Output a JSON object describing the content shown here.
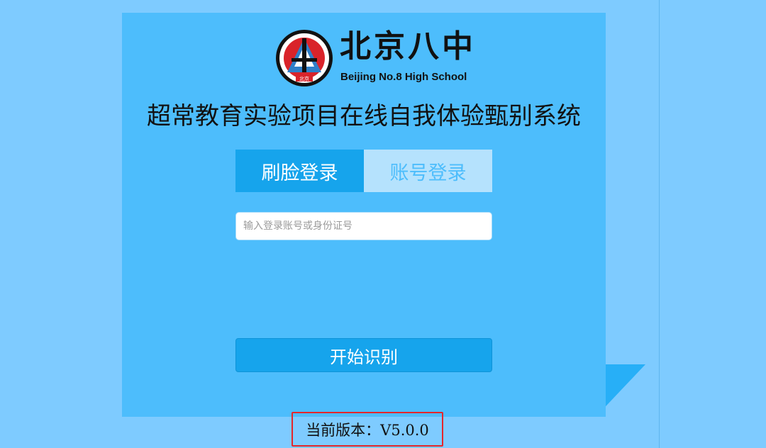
{
  "logo": {
    "name_cn": "北京八中",
    "name_en": "Beijing No.8 High School",
    "emblem_text": "北京"
  },
  "page_title": "超常教育实验项目在线自我体验甄别系统",
  "tabs": [
    {
      "label": "刷脸登录",
      "active": true
    },
    {
      "label": "账号登录",
      "active": false
    }
  ],
  "account_input": {
    "value": "",
    "placeholder": "输入登录账号或身份证号"
  },
  "start_button": {
    "label": "开始识别"
  },
  "version": {
    "text": "当前版本：V5.0.0"
  },
  "colors": {
    "background": "#7ecbff",
    "panel": "#4dbdfc",
    "active_tab": "#16a4ec",
    "inactive_tab": "#b5e2fd",
    "highlight_box": "#e5262a"
  }
}
